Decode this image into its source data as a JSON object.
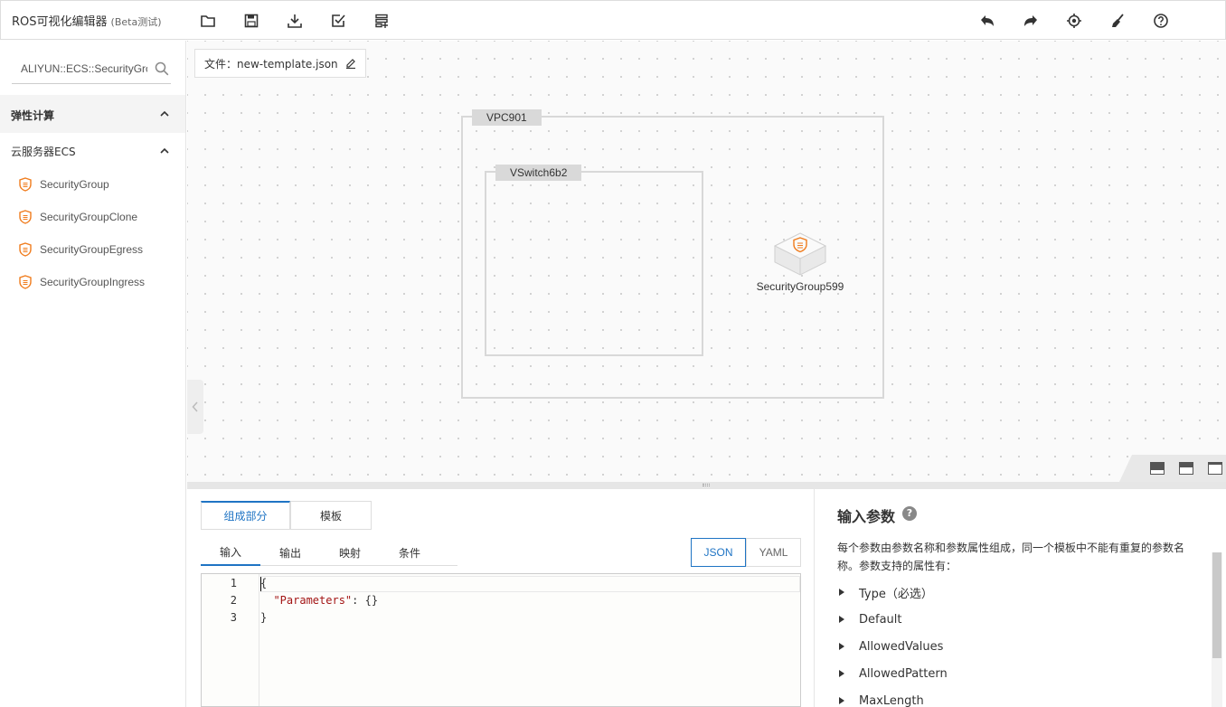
{
  "app": {
    "title": "ROS可视化编辑器",
    "beta": "(Beta测试)"
  },
  "toolbar": {
    "left_icons": [
      "folder-icon",
      "save-icon",
      "download-icon",
      "check-icon",
      "add-list-icon"
    ],
    "right_icons": [
      "undo-icon",
      "redo-icon",
      "locate-icon",
      "clear-icon",
      "help-icon"
    ]
  },
  "sidebar": {
    "search": {
      "value": "ALIYUN::ECS::SecurityGrou",
      "placeholder": ""
    },
    "category": "弹性计算",
    "subcategory": "云服务器ECS",
    "items": [
      {
        "label": "SecurityGroup"
      },
      {
        "label": "SecurityGroupClone"
      },
      {
        "label": "SecurityGroupEgress"
      },
      {
        "label": "SecurityGroupIngress"
      }
    ]
  },
  "canvas": {
    "file_label": "文件：new-template.json",
    "vpc_label": "VPC901",
    "vswitch_label": "VSwitch6b2",
    "node_label": "SecurityGroup599"
  },
  "editor": {
    "main_tabs": [
      "组成部分",
      "模板"
    ],
    "active_main_tab": "组成部分",
    "sub_tabs": [
      "输入",
      "输出",
      "映射",
      "条件"
    ],
    "active_sub_tab": "输入",
    "formats": [
      "JSON",
      "YAML"
    ],
    "active_format": "JSON",
    "code_lines": [
      {
        "n": "1",
        "text": "{"
      },
      {
        "n": "2",
        "key": "\"Parameters\"",
        "rest": ": {}"
      },
      {
        "n": "3",
        "text": "}"
      }
    ]
  },
  "help": {
    "title": "输入参数",
    "help_glyph": "?",
    "description": "每个参数由参数名称和参数属性组成，同一个模板中不能有重复的参数名称。参数支持的属性有：",
    "properties": [
      "Type（必选）",
      "Default",
      "AllowedValues",
      "AllowedPattern",
      "MaxLength"
    ]
  },
  "colors": {
    "accent": "#1f74c4",
    "icon_orange": "#f07c1d"
  }
}
